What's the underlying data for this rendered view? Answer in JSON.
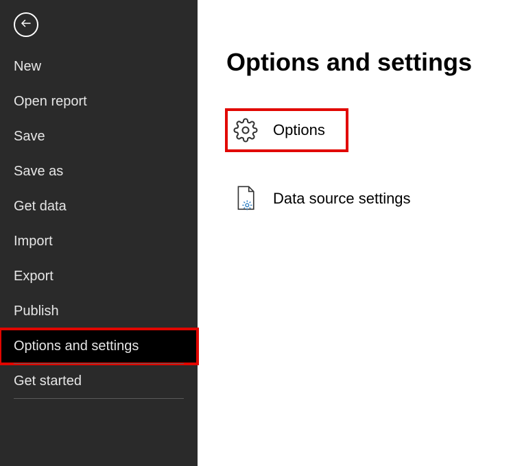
{
  "sidebar": {
    "items": [
      {
        "label": "New"
      },
      {
        "label": "Open report"
      },
      {
        "label": "Save"
      },
      {
        "label": "Save as"
      },
      {
        "label": "Get data"
      },
      {
        "label": "Import"
      },
      {
        "label": "Export"
      },
      {
        "label": "Publish"
      },
      {
        "label": "Options and settings"
      },
      {
        "label": "Get started"
      }
    ]
  },
  "panel": {
    "title": "Options and settings",
    "options": {
      "options_label": "Options",
      "data_source_label": "Data source settings"
    }
  }
}
